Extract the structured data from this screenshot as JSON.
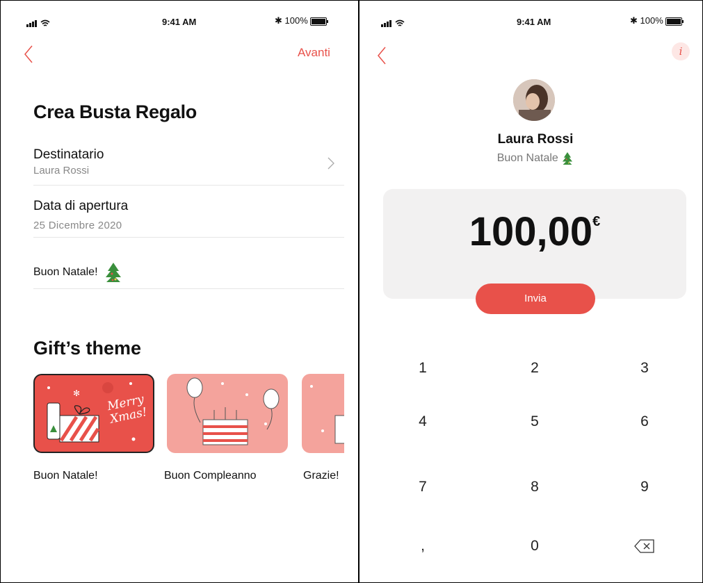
{
  "left": {
    "status": {
      "time": "9:41 AM",
      "battery": "100%"
    },
    "nav": {
      "next": "Avanti"
    },
    "title": "Crea Busta Regalo",
    "recipient": {
      "label": "Destinatario",
      "value": "Laura Rossi"
    },
    "date": {
      "label": "Data di apertura",
      "value": "25 Dicembre 2020"
    },
    "message": "Buon Natale!",
    "theme_title": "Gift’s theme",
    "themes": [
      {
        "label": "Buon Natale!",
        "card_text": "Merry Xmas!"
      },
      {
        "label": "Buon Compleanno"
      },
      {
        "label": "Grazie!"
      }
    ]
  },
  "right": {
    "status": {
      "time": "9:41 AM",
      "battery": "100%"
    },
    "info_icon": "i",
    "name": "Laura Rossi",
    "subtitle": "Buon Natale",
    "amount": "100,00",
    "currency": "€",
    "send": "Invia",
    "keys": [
      "1",
      "2",
      "3",
      "4",
      "5",
      "6",
      "7",
      "8",
      "9",
      ",",
      "0"
    ]
  },
  "colors": {
    "accent": "#e8514a",
    "card_red": "#e8514a",
    "card_pink": "#f4a39c",
    "amount_bg": "#f2f1f1"
  }
}
